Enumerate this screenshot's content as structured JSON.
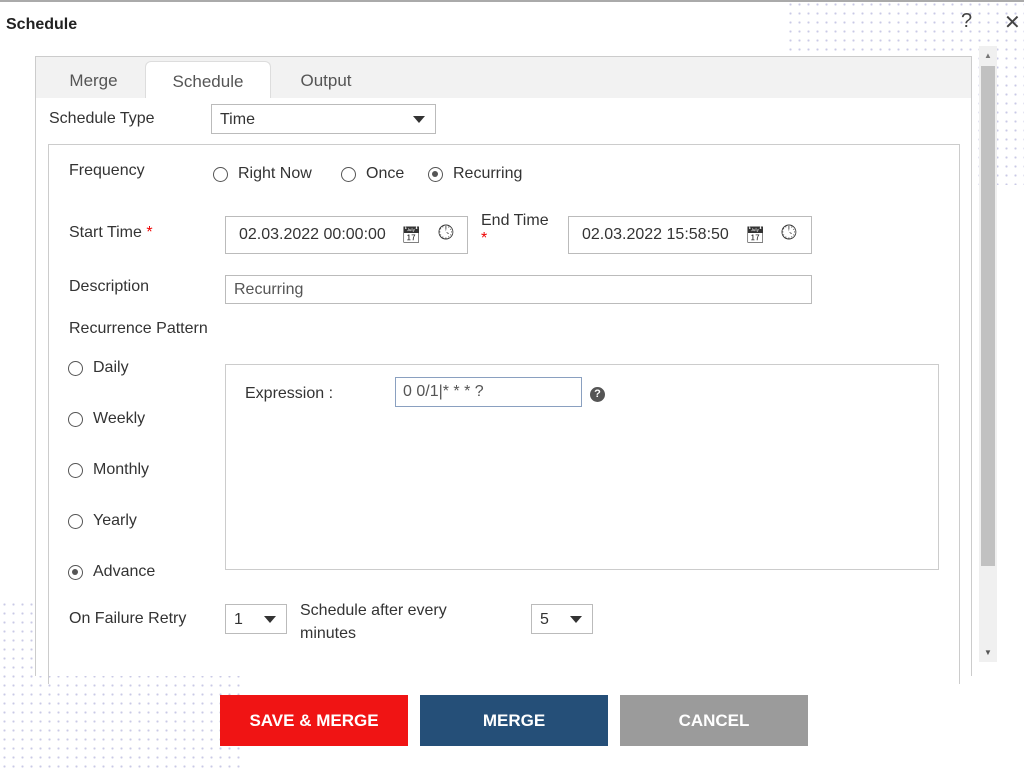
{
  "dialog": {
    "title": "Schedule"
  },
  "tabs": [
    {
      "label": "Merge"
    },
    {
      "label": "Schedule",
      "active": true
    },
    {
      "label": "Output"
    }
  ],
  "schedule_type": {
    "label": "Schedule Type",
    "value": "Time"
  },
  "frequency": {
    "label": "Frequency",
    "options": [
      "Right Now",
      "Once",
      "Recurring"
    ],
    "selected": "Recurring"
  },
  "start_time": {
    "label": "Start Time",
    "required": "*",
    "value": "02.03.2022 00:00:00"
  },
  "end_time": {
    "label": "End Time",
    "required": "*",
    "value": "02.03.2022 15:58:50"
  },
  "description": {
    "label": "Description",
    "value": "Recurring"
  },
  "recurrence": {
    "label": "Recurrence Pattern",
    "options": [
      "Daily",
      "Weekly",
      "Monthly",
      "Yearly",
      "Advance"
    ],
    "selected": "Advance"
  },
  "expression": {
    "label": "Expression :",
    "value": "0 0/1|* * * ?"
  },
  "retry": {
    "label": "On Failure Retry",
    "value": "1"
  },
  "schedule_after": {
    "label": "Schedule after every minutes",
    "value": "5"
  },
  "buttons": {
    "save_merge": "SAVE & MERGE",
    "merge": "MERGE",
    "cancel": "CANCEL"
  },
  "colors": {
    "save": "#f01414",
    "merge": "#254f78",
    "cancel": "#9b9b9b"
  }
}
